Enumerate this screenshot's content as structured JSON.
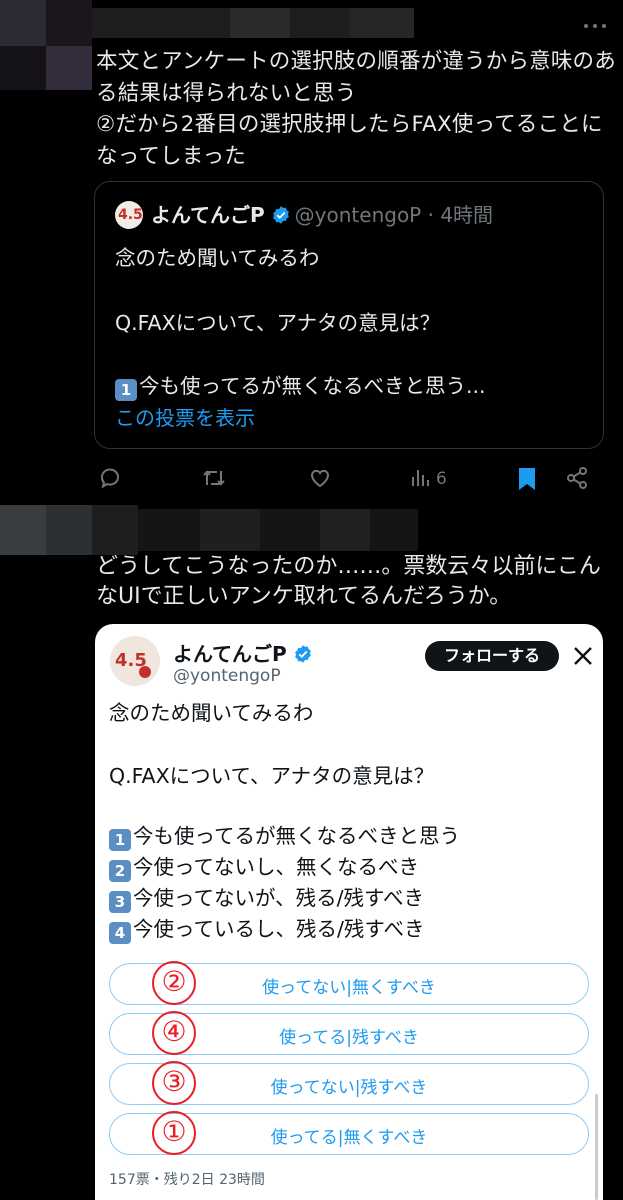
{
  "post1": {
    "text": "本文とアンケートの選択肢の順番が違うから意味のある結果は得られないと思う\n②だから2番目の選択肢押したらFAX使ってることになってしまった",
    "quote": {
      "name": "よんてんごP",
      "handle": "@yontengoP",
      "separator": " · ",
      "time": "4時間",
      "line1": "念のため聞いてみるわ",
      "line2": "Q.FAXについて、アナタの意見は？",
      "keycap": "1",
      "line3": "今も使ってるが無くなるべきと思う...",
      "link": "この投票を表示"
    },
    "actions": {
      "views": "6"
    }
  },
  "post2": {
    "text": "どうしてこうなったのか……。票数云々以前にこんなUIで正しいアンケ取れてるんだろうか。"
  },
  "screenshot": {
    "name": "よんてんごP",
    "handle": "@yontengoP",
    "follow": "フォローする",
    "line1": "念のため聞いてみるわ",
    "line2": "Q.FAXについて、アナタの意見は？",
    "choices": [
      {
        "key": "1",
        "text": "今も使ってるが無くなるべきと思う"
      },
      {
        "key": "2",
        "text": "今使ってないし、無くなるべき"
      },
      {
        "key": "3",
        "text": "今使ってないが、残る/残すべき"
      },
      {
        "key": "4",
        "text": "今使っているし、残る/残すべき"
      }
    ],
    "poll": [
      {
        "mark": "②",
        "label": "使ってない|無くすべき"
      },
      {
        "mark": "④",
        "label": "使ってる|残すべき"
      },
      {
        "mark": "③",
        "label": "使ってない|残すべき"
      },
      {
        "mark": "①",
        "label": "使ってる|無くすべき"
      }
    ],
    "footer": "157票・残り2日 23時間"
  },
  "colors": {
    "accent": "#1d9bf0",
    "bookmark": "#1d9bf0",
    "annotation": "#ec1c24"
  }
}
